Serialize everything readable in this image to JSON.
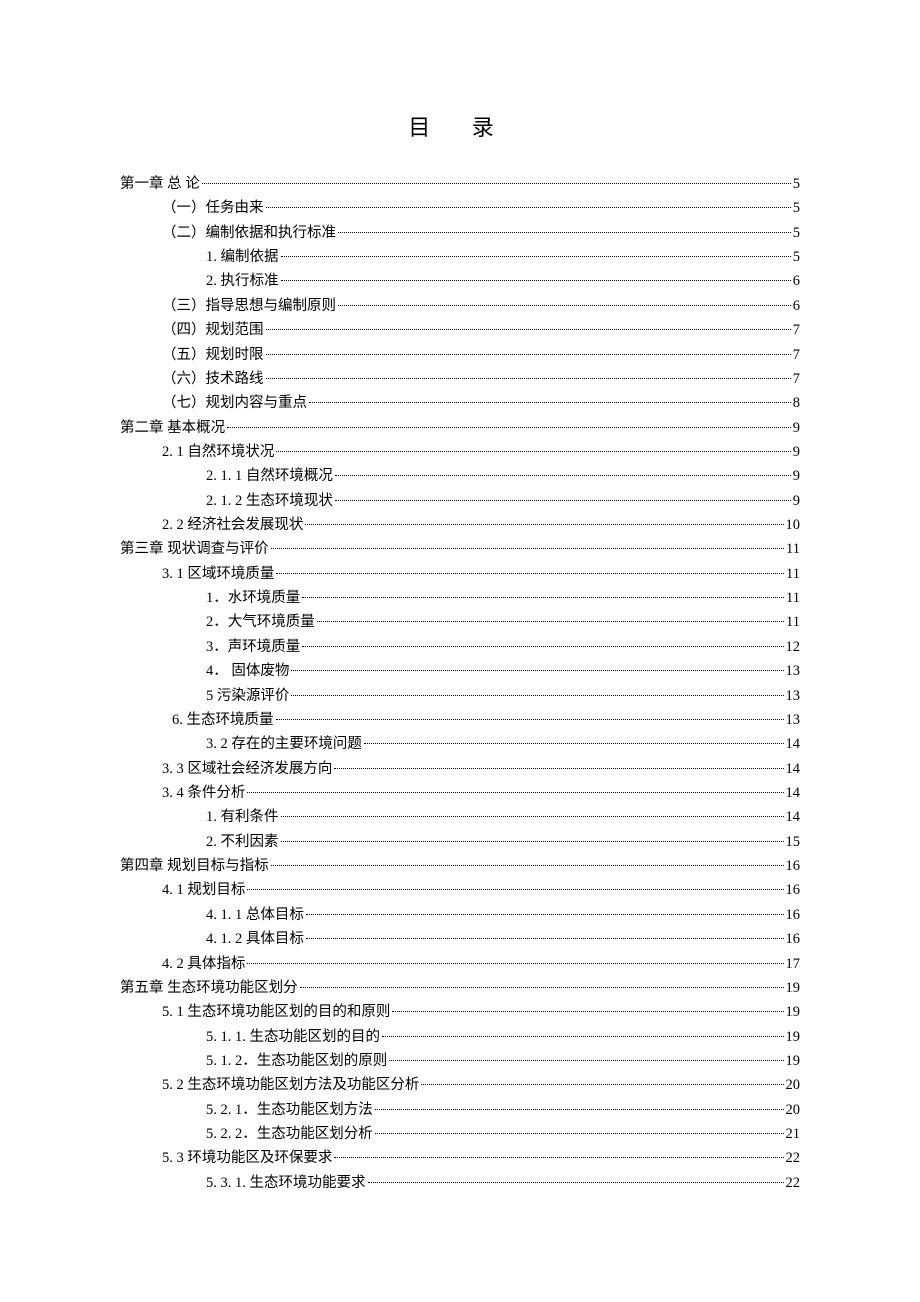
{
  "title": "目 录",
  "entries": [
    {
      "indent": "l0",
      "text": "第一章 总  论",
      "page": "5"
    },
    {
      "indent": "l1",
      "text": "（一）任务由来",
      "page": "5"
    },
    {
      "indent": "l1",
      "text": "（二）编制依据和执行标准",
      "page": "5"
    },
    {
      "indent": "l2",
      "text": "1. 编制依据",
      "page": "5"
    },
    {
      "indent": "l2",
      "text": "2. 执行标准",
      "page": "6"
    },
    {
      "indent": "l1",
      "text": "（三）指导思想与编制原则",
      "page": "6"
    },
    {
      "indent": "l1",
      "text": "（四）规划范围",
      "page": "7"
    },
    {
      "indent": "l1",
      "text": "（五）规划时限",
      "page": "7"
    },
    {
      "indent": "l1",
      "text": "（六）技术路线",
      "page": "7"
    },
    {
      "indent": "l1",
      "text": "（七）规划内容与重点",
      "page": "8"
    },
    {
      "indent": "l0",
      "text": "第二章 基本概况",
      "page": "9"
    },
    {
      "indent": "l1",
      "text": "2. 1 自然环境状况",
      "page": "9"
    },
    {
      "indent": "l2",
      "text": "2. 1. 1 自然环境概况",
      "page": "9"
    },
    {
      "indent": "l2",
      "text": "2. 1. 2 生态环境现状",
      "page": "9"
    },
    {
      "indent": "l1",
      "text": "2. 2 经济社会发展现状",
      "page": "10"
    },
    {
      "indent": "l0",
      "text": "第三章 现状调查与评价",
      "page": "11"
    },
    {
      "indent": "l1",
      "text": "3. 1 区域环境质量",
      "page": "11"
    },
    {
      "indent": "l2",
      "text": "1．水环境质量",
      "page": "11"
    },
    {
      "indent": "l2",
      "text": "2．大气环境质量",
      "page": "11"
    },
    {
      "indent": "l2",
      "text": "3．声环境质量",
      "page": "12"
    },
    {
      "indent": "l2",
      "text": "4．  固体废物",
      "page": "13"
    },
    {
      "indent": "l2",
      "text": "5 污染源评价",
      "page": "13"
    },
    {
      "indent": "l3",
      "text": "6. 生态环境质量",
      "page": "13"
    },
    {
      "indent": "l2",
      "text": "3. 2 存在的主要环境问题",
      "page": "14"
    },
    {
      "indent": "l1",
      "text": "3. 3 区域社会经济发展方向",
      "page": "14"
    },
    {
      "indent": "l1",
      "text": "3. 4 条件分析",
      "page": "14"
    },
    {
      "indent": "l2",
      "text": "1. 有利条件",
      "page": "14"
    },
    {
      "indent": "l2",
      "text": "2. 不利因素",
      "page": "15"
    },
    {
      "indent": "l0",
      "text": "第四章 规划目标与指标",
      "page": "16"
    },
    {
      "indent": "l1",
      "text": "4. 1 规划目标",
      "page": "16"
    },
    {
      "indent": "l2",
      "text": "4. 1. 1 总体目标",
      "page": "16"
    },
    {
      "indent": "l2",
      "text": "4. 1. 2 具体目标",
      "page": "16"
    },
    {
      "indent": "l1",
      "text": "4. 2 具体指标",
      "page": "17"
    },
    {
      "indent": "l0",
      "text": "第五章  生态环境功能区划分",
      "page": "19"
    },
    {
      "indent": "l1",
      "text": "5. 1 生态环境功能区划的目的和原则",
      "page": "19"
    },
    {
      "indent": "l2",
      "text": "5. 1. 1. 生态功能区划的目的",
      "page": "19"
    },
    {
      "indent": "l2",
      "text": "5. 1. 2．生态功能区划的原则",
      "page": "19"
    },
    {
      "indent": "l1",
      "text": "5. 2 生态环境功能区划方法及功能区分析",
      "page": "20"
    },
    {
      "indent": "l2",
      "text": "5. 2. 1．生态功能区划方法",
      "page": "20"
    },
    {
      "indent": "l2",
      "text": "5. 2. 2．生态功能区划分析",
      "page": "21"
    },
    {
      "indent": "l1",
      "text": "5. 3 环境功能区及环保要求",
      "page": "22"
    },
    {
      "indent": "l2",
      "text": "5. 3. 1. 生态环境功能要求",
      "page": "22"
    }
  ]
}
